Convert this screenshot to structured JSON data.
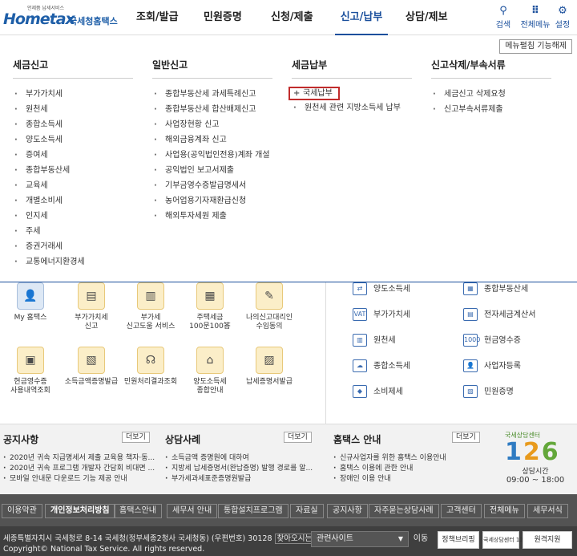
{
  "header": {
    "logo_tagline": "언제쯤 납세서비스",
    "logo_main": "Hometax",
    "logo_sub": "국세청홈택스",
    "nav": [
      "조회/발급",
      "민원증명",
      "신청/제출",
      "신고/납부",
      "상담/제보"
    ],
    "active_nav": "신고/납부",
    "search_label": "검색",
    "allmenu_label": "전체메뉴",
    "settings_label": "설정"
  },
  "mega": {
    "menu_setting_label": "메뉴펼침 기능해제",
    "columns": [
      {
        "title": "세금신고",
        "items": [
          "부가가치세",
          "원천세",
          "종합소득세",
          "양도소득세",
          "증여세",
          "종합부동산세",
          "교육세",
          "개별소비세",
          "인지세",
          "주세",
          "증권거래세",
          "교통에너지환경세"
        ]
      },
      {
        "title": "일반신고",
        "items": [
          "종합부동산세 과세특례신고",
          "종합부동산세 합산배제신고",
          "사업장현황 신고",
          "해외금융계좌 신고",
          "사업용(공익법인전용)계좌 개설",
          "공익법인 보고서제출",
          "기부금영수증발급명세서",
          "농어업용기자재환급신청",
          "해외투자세원 제출"
        ]
      },
      {
        "title": "세금납부",
        "items": [
          "국세납부",
          "원천세 관련 지방소득세 납부"
        ]
      },
      {
        "title": "신고삭제/부속서류",
        "items": [
          "세금신고 삭제요청",
          "신고부속서류제출"
        ]
      }
    ]
  },
  "quick": {
    "left": [
      {
        "label": "My 홈택스",
        "icon": "person-icon"
      },
      {
        "label": "부가가치세\n신고",
        "icon": "vat-doc-icon"
      },
      {
        "label": "부가세\n신고도움 서비스",
        "icon": "vat-help-icon"
      },
      {
        "label": "주택세금\n100문100答",
        "icon": "building-icon"
      },
      {
        "label": "나의신고대리인\n수임동의",
        "icon": "pen-doc-icon"
      },
      {
        "label": "현금영수증\n사용내역조회",
        "icon": "receipt-icon"
      },
      {
        "label": "소득금액증명발급",
        "icon": "cert-icon"
      },
      {
        "label": "민원처리결과조회",
        "icon": "headset-icon"
      },
      {
        "label": "양도소득세\n종합안내",
        "icon": "house-icon"
      },
      {
        "label": "납세증명서발급",
        "icon": "stamp-doc-icon"
      }
    ],
    "right": [
      {
        "label": "양도소득세",
        "icon": "transfer-icon"
      },
      {
        "label": "종합부동산세",
        "icon": "property-icon"
      },
      {
        "label": "부가가치세",
        "icon": "vat-icon"
      },
      {
        "label": "전자세금계산서",
        "icon": "invoice-icon"
      },
      {
        "label": "원천세",
        "icon": "withholding-icon"
      },
      {
        "label": "현금영수증",
        "icon": "cash-receipt-icon"
      },
      {
        "label": "종합소득세",
        "icon": "income-icon"
      },
      {
        "label": "사업자등록",
        "icon": "business-icon"
      },
      {
        "label": "소비제세",
        "icon": "diamond-icon"
      },
      {
        "label": "민원증명",
        "icon": "document-icon"
      }
    ]
  },
  "notice": {
    "more_label": "더보기",
    "boards": [
      {
        "title": "공지사항",
        "items": [
          "2020년 귀속 지급명세서 제출 교육용 책자·동...",
          "2020년 귀속 프로그램 개발자 간담회 비대면 ...",
          "모바일 안내문 다운로드 기능 제공 안내"
        ]
      },
      {
        "title": "상담사례",
        "items": [
          "소득금액 증명원에 대하여",
          "지방세 납세증명서(완납증명) 발행 경로를 알...",
          "부가세과세표준증명원발급"
        ]
      },
      {
        "title": "홈택스 안내",
        "items": [
          "신규사업자를 위한 홈택스 이용안내",
          "홈택스 이용에 관한 안내",
          "장애인 이용 안내"
        ]
      }
    ],
    "call_center": {
      "label": "국세상담센터",
      "number": [
        "1",
        "2",
        "6"
      ],
      "hours_label": "상담시간",
      "hours": "09:00 ~ 18:00"
    }
  },
  "footer": {
    "nav": [
      "이용약관",
      "개인정보처리방침",
      "홈택스안내",
      "세무서 안내",
      "통합설치프로그램",
      "자료실",
      "공지사항",
      "자주묻는상담사례",
      "고객센터",
      "전체메뉴",
      "세무서식"
    ],
    "address": "세종특별자치시 국세청로 8-14 국세청(정부세종2청사 국세청동) (우편번호) 30128",
    "map_link": "찾아오시는 길",
    "copyright": "Copyright© National Tax Service. All rights reserved.",
    "related_select": "관련사이트",
    "go_label": "이동",
    "badges": [
      "정책브리핑",
      "국세상담센터 126",
      "원격지원"
    ]
  }
}
